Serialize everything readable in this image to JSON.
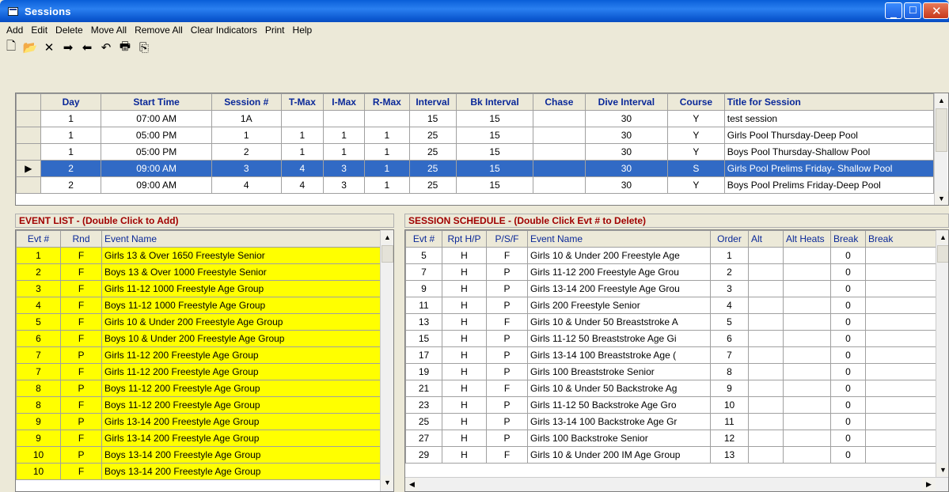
{
  "window": {
    "title": "Sessions"
  },
  "menu": [
    "Add",
    "Edit",
    "Delete",
    "Move All",
    "Remove All",
    "Clear Indicators",
    "Print",
    "Help"
  ],
  "toolbar": [
    {
      "name": "new-icon",
      "glyph": "🗋"
    },
    {
      "name": "open-icon",
      "glyph": "📂"
    },
    {
      "name": "delete-icon",
      "glyph": "✕"
    },
    {
      "name": "move-right-icon",
      "glyph": "➡"
    },
    {
      "name": "move-left-icon",
      "glyph": "⬅"
    },
    {
      "name": "undo-icon",
      "glyph": "↶"
    },
    {
      "name": "print-icon",
      "glyph": "🖶"
    },
    {
      "name": "export-icon",
      "glyph": "⎘"
    }
  ],
  "sessions": {
    "columns": [
      "Day",
      "Start Time",
      "Session #",
      "T-Max",
      "I-Max",
      "R-Max",
      "Interval",
      "Bk Interval",
      "Chase",
      "Dive Interval",
      "Course",
      "Title for Session"
    ],
    "rows": [
      [
        "1",
        "07:00 AM",
        "1A",
        "",
        "",
        "",
        "15",
        "15",
        "",
        "30",
        "Y",
        "test session"
      ],
      [
        "1",
        "05:00 PM",
        "1",
        "1",
        "1",
        "1",
        "25",
        "15",
        "",
        "30",
        "Y",
        "Girls Pool Thursday-Deep Pool"
      ],
      [
        "1",
        "05:00 PM",
        "2",
        "1",
        "1",
        "1",
        "25",
        "15",
        "",
        "30",
        "Y",
        "Boys Pool Thursday-Shallow Pool"
      ],
      [
        "2",
        "09:00 AM",
        "3",
        "4",
        "3",
        "1",
        "25",
        "15",
        "",
        "30",
        "S",
        "Girls Pool Prelims Friday- Shallow Pool"
      ],
      [
        "2",
        "09:00 AM",
        "4",
        "4",
        "3",
        "1",
        "25",
        "15",
        "",
        "30",
        "Y",
        "Boys Pool Prelims Friday-Deep Pool"
      ]
    ],
    "selected_row": 3
  },
  "event_list": {
    "header": "EVENT LIST - (Double Click to Add)",
    "columns": [
      "Evt #",
      "Rnd",
      "Event Name"
    ],
    "rows": [
      [
        "1",
        "F",
        "Girls 13 & Over 1650 Freestyle Senior"
      ],
      [
        "2",
        "F",
        "Boys 13 & Over 1000 Freestyle Senior"
      ],
      [
        "3",
        "F",
        "Girls 11-12 1000 Freestyle Age Group"
      ],
      [
        "4",
        "F",
        "Boys 11-12 1000 Freestyle Age Group"
      ],
      [
        "5",
        "F",
        "Girls 10 & Under 200 Freestyle Age Group"
      ],
      [
        "6",
        "F",
        "Boys 10 & Under 200 Freestyle Age Group"
      ],
      [
        "7",
        "P",
        "Girls 11-12 200 Freestyle Age Group"
      ],
      [
        "7",
        "F",
        "Girls 11-12 200 Freestyle Age Group"
      ],
      [
        "8",
        "P",
        "Boys 11-12 200 Freestyle Age Group"
      ],
      [
        "8",
        "F",
        "Boys 11-12 200 Freestyle Age Group"
      ],
      [
        "9",
        "P",
        "Girls 13-14 200 Freestyle Age Group"
      ],
      [
        "9",
        "F",
        "Girls 13-14 200 Freestyle Age Group"
      ],
      [
        "10",
        "P",
        "Boys 13-14 200 Freestyle Age Group"
      ],
      [
        "10",
        "F",
        "Boys 13-14 200 Freestyle Age Group"
      ]
    ]
  },
  "schedule": {
    "header": "SESSION SCHEDULE - (Double Click Evt # to Delete)",
    "columns": [
      "Evt #",
      "Rpt H/P",
      "P/S/F",
      "Event Name",
      "Order",
      "Alt",
      "Alt Heats",
      "Break",
      "Break"
    ],
    "rows": [
      [
        "5",
        "H",
        "F",
        "Girls 10 & Under 200 Freestyle Age",
        "1",
        "",
        "",
        "0",
        ""
      ],
      [
        "7",
        "H",
        "P",
        "Girls 11-12 200 Freestyle Age Grou",
        "2",
        "",
        "",
        "0",
        ""
      ],
      [
        "9",
        "H",
        "P",
        "Girls 13-14 200 Freestyle Age Grou",
        "3",
        "",
        "",
        "0",
        ""
      ],
      [
        "11",
        "H",
        "P",
        "Girls 200 Freestyle Senior",
        "4",
        "",
        "",
        "0",
        ""
      ],
      [
        "13",
        "H",
        "F",
        "Girls 10 & Under 50 Breaststroke A",
        "5",
        "",
        "",
        "0",
        ""
      ],
      [
        "15",
        "H",
        "P",
        "Girls 11-12 50 Breaststroke Age Gi",
        "6",
        "",
        "",
        "0",
        ""
      ],
      [
        "17",
        "H",
        "P",
        "Girls 13-14 100 Breaststroke Age (",
        "7",
        "",
        "",
        "0",
        ""
      ],
      [
        "19",
        "H",
        "P",
        "Girls 100 Breaststroke Senior",
        "8",
        "",
        "",
        "0",
        ""
      ],
      [
        "21",
        "H",
        "F",
        "Girls 10 & Under 50 Backstroke Ag",
        "9",
        "",
        "",
        "0",
        ""
      ],
      [
        "23",
        "H",
        "P",
        "Girls 11-12 50 Backstroke Age Gro",
        "10",
        "",
        "",
        "0",
        ""
      ],
      [
        "25",
        "H",
        "P",
        "Girls 13-14 100 Backstroke Age Gr",
        "11",
        "",
        "",
        "0",
        ""
      ],
      [
        "27",
        "H",
        "P",
        "Girls 100 Backstroke Senior",
        "12",
        "",
        "",
        "0",
        ""
      ],
      [
        "29",
        "H",
        "F",
        "Girls 10 & Under 200 IM Age Group",
        "13",
        "",
        "",
        "0",
        ""
      ]
    ]
  }
}
